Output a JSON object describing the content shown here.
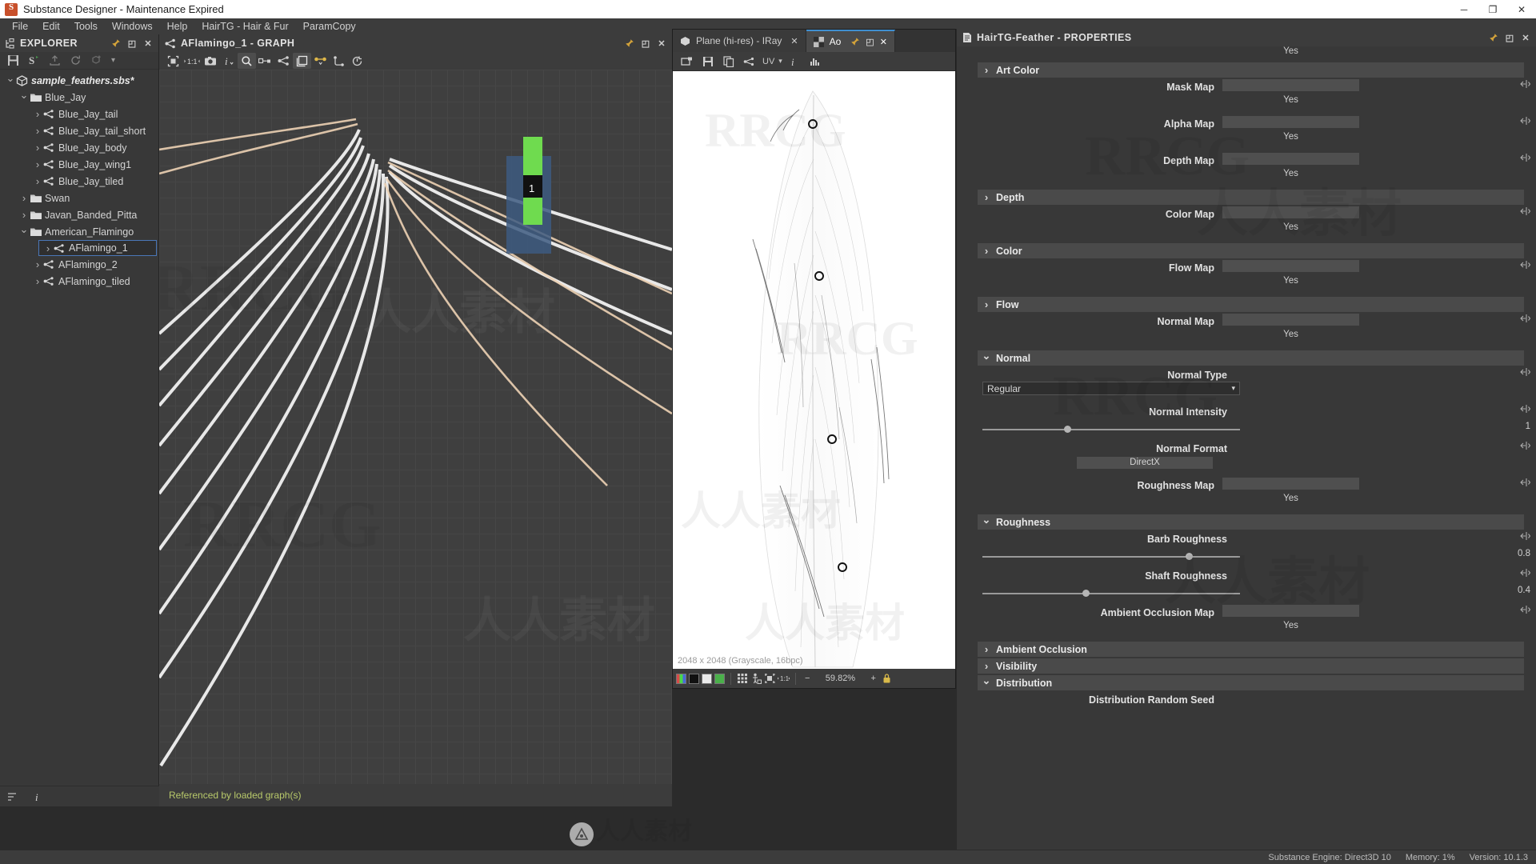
{
  "window": {
    "title": "Substance Designer - Maintenance Expired",
    "minimize": "─",
    "maximize": "❐",
    "close": "✕"
  },
  "menubar": {
    "items": [
      {
        "label": "File"
      },
      {
        "label": "Edit"
      },
      {
        "label": "Tools"
      },
      {
        "label": "Windows"
      },
      {
        "label": "Help"
      },
      {
        "label": "HairTG - Hair & Fur"
      },
      {
        "label": "ParamCopy"
      }
    ]
  },
  "explorer": {
    "title": "EXPLORER",
    "pin": "📌",
    "float": "◰",
    "close": "✕",
    "footer_icons": [
      "sort-icon",
      "info-icon"
    ],
    "tree": [
      {
        "label": "sample_feathers.sbs*",
        "depth": 0,
        "arrow": "open",
        "icon": "package",
        "kind": "package",
        "selected": false
      },
      {
        "label": "Blue_Jay",
        "depth": 1,
        "arrow": "open",
        "icon": "folder",
        "kind": "folder",
        "selected": false
      },
      {
        "label": "Blue_Jay_tail",
        "depth": 2,
        "arrow": "closed",
        "icon": "graph",
        "kind": "graph",
        "selected": false
      },
      {
        "label": "Blue_Jay_tail_short",
        "depth": 2,
        "arrow": "closed",
        "icon": "graph",
        "kind": "graph",
        "selected": false
      },
      {
        "label": "Blue_Jay_body",
        "depth": 2,
        "arrow": "closed",
        "icon": "graph",
        "kind": "graph",
        "selected": false
      },
      {
        "label": "Blue_Jay_wing1",
        "depth": 2,
        "arrow": "closed",
        "icon": "graph",
        "kind": "graph",
        "selected": false
      },
      {
        "label": "Blue_Jay_tiled",
        "depth": 2,
        "arrow": "closed",
        "icon": "graph",
        "kind": "graph",
        "selected": false
      },
      {
        "label": "Swan",
        "depth": 1,
        "arrow": "closed",
        "icon": "folder",
        "kind": "folder",
        "selected": false
      },
      {
        "label": "Javan_Banded_Pitta",
        "depth": 1,
        "arrow": "closed",
        "icon": "folder",
        "kind": "folder",
        "selected": false
      },
      {
        "label": "American_Flamingo",
        "depth": 1,
        "arrow": "open",
        "icon": "folder",
        "kind": "folder",
        "selected": false
      },
      {
        "label": "AFlamingo_1",
        "depth": 2,
        "arrow": "closed",
        "icon": "graph",
        "kind": "graph",
        "selected": true
      },
      {
        "label": "AFlamingo_2",
        "depth": 2,
        "arrow": "closed",
        "icon": "graph",
        "kind": "graph",
        "selected": false
      },
      {
        "label": "AFlamingo_tiled",
        "depth": 2,
        "arrow": "closed",
        "icon": "graph",
        "kind": "graph",
        "selected": false
      }
    ]
  },
  "graph": {
    "title": "AFlamingo_1 - GRAPH",
    "pin": "📌",
    "float": "◰",
    "close": "✕",
    "status": "Referenced by loaded graph(s)",
    "toolbar_row1": [
      "select-icon",
      "ratio-1-1-icon",
      "camera-icon",
      "info-icon",
      "search-icon",
      "link-icon",
      "graph-icon",
      "layers-icon",
      "node-connect-icon",
      "path-icon",
      "timer-icon"
    ],
    "toolbar_row2": [
      "arrow-icon",
      "pin-node-icon",
      "align-icon",
      "export-icon",
      "import-icon",
      "crop-icon",
      "gem-icon",
      "frame-icon",
      "grid-snap-icon"
    ]
  },
  "viewer": {
    "tabs": [
      {
        "label": "Plane (hi-res) - IRay",
        "icon": "cube-icon",
        "active": false,
        "close": "✕"
      },
      {
        "label": "Ao",
        "icon": "checker-icon",
        "active": true,
        "close": "✕"
      }
    ],
    "tab_pin": "📌",
    "tab_float": "◰",
    "toolbar": [
      "new-view-icon",
      "save-icon",
      "copy-icon",
      "uv-icon",
      "info-icon",
      "histogram-icon"
    ],
    "uv_label": "UV",
    "image_info": "2048 x 2048 (Grayscale, 16bpc)",
    "bottom": {
      "grid_icon": "grid-icon",
      "person_icon": "person-icon",
      "tile_icon": "tile-icon",
      "move_icon": "move-icon",
      "minus": "−",
      "zoom": "59.82%",
      "plus": "+",
      "lock_icon": "lock-icon",
      "channels": [
        "rgb-swatch",
        "black-swatch",
        "gray-swatch",
        "green-swatch"
      ]
    }
  },
  "properties": {
    "title": "HairTG-Feather - PROPERTIES",
    "pin": "📌",
    "float": "◰",
    "close": "✕",
    "top_partial_value": "Yes",
    "sections": [
      {
        "kind": "header",
        "label": "Art Color",
        "arrow": "closed",
        "name": "section-art-color"
      },
      {
        "kind": "map",
        "label": "Mask Map",
        "value": "Yes",
        "name": "prop-mask-map"
      },
      {
        "kind": "map",
        "label": "Alpha Map",
        "value": "Yes",
        "name": "prop-alpha-map"
      },
      {
        "kind": "map",
        "label": "Depth Map",
        "value": "Yes",
        "name": "prop-depth-map"
      },
      {
        "kind": "header",
        "label": "Depth",
        "arrow": "closed",
        "name": "section-depth"
      },
      {
        "kind": "map",
        "label": "Color  Map",
        "value": "Yes",
        "name": "prop-color-map"
      },
      {
        "kind": "header",
        "label": "Color",
        "arrow": "closed",
        "name": "section-color"
      },
      {
        "kind": "map",
        "label": "Flow  Map",
        "value": "Yes",
        "name": "prop-flow-map"
      },
      {
        "kind": "header",
        "label": "Flow",
        "arrow": "closed",
        "name": "section-flow"
      },
      {
        "kind": "map",
        "label": "Normal Map",
        "value": "Yes",
        "name": "prop-normal-map"
      },
      {
        "kind": "header",
        "label": "Normal",
        "arrow": "open",
        "name": "section-normal"
      },
      {
        "kind": "select",
        "label": "Normal Type",
        "value": "Regular",
        "name": "prop-normal-type"
      },
      {
        "kind": "slider",
        "label": "Normal Intensity",
        "value": "1",
        "fill": 0.33,
        "name": "prop-normal-intensity"
      },
      {
        "kind": "button",
        "label": "Normal Format",
        "value": "DirectX",
        "name": "prop-normal-format"
      },
      {
        "kind": "map",
        "label": "Roughness Map",
        "value": "Yes",
        "name": "prop-roughness-map"
      },
      {
        "kind": "header",
        "label": "Roughness",
        "arrow": "open",
        "name": "section-roughness"
      },
      {
        "kind": "slider",
        "label": "Barb Roughness",
        "value": "0.8",
        "fill": 0.8,
        "name": "prop-barb-roughness"
      },
      {
        "kind": "slider",
        "label": "Shaft Roughness",
        "value": "0.4",
        "fill": 0.4,
        "name": "prop-shaft-roughness"
      },
      {
        "kind": "map",
        "label": "Ambient Occlusion Map",
        "value": "Yes",
        "name": "prop-ambient-occlusion-map"
      },
      {
        "kind": "header",
        "label": "Ambient Occlusion",
        "arrow": "closed",
        "name": "section-ambient-occlusion"
      },
      {
        "kind": "header",
        "label": "Visibility",
        "arrow": "closed",
        "name": "section-visibility"
      },
      {
        "kind": "header",
        "label": "Distribution",
        "arrow": "open",
        "name": "section-distribution"
      },
      {
        "kind": "label-only",
        "label": "Distribution Random Seed",
        "name": "prop-distribution-random-seed"
      }
    ]
  },
  "statusbar": {
    "engine": "Substance Engine: Direct3D 10",
    "memory": "Memory: 1%",
    "version": "Version: 10.1.3"
  },
  "watermarks": {
    "rrcg": "RRCG",
    "cn": "人人素材"
  },
  "colors": {
    "accent_blue": "#3f8fd0",
    "selection_border": "#4a77b8",
    "status_green": "#b8c96a",
    "panel_bg": "#383838",
    "header_bg": "#4a4a4a"
  }
}
